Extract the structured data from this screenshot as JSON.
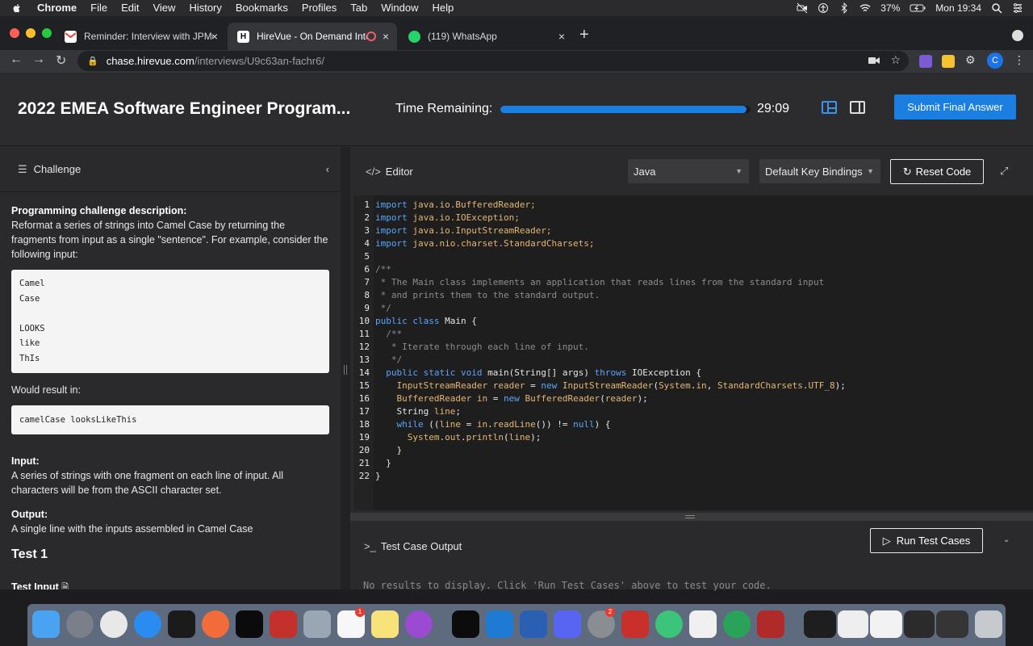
{
  "menubar": {
    "app": "Chrome",
    "items": [
      "File",
      "Edit",
      "View",
      "History",
      "Bookmarks",
      "Profiles",
      "Tab",
      "Window",
      "Help"
    ],
    "battery": "37%",
    "clock": "Mon 19:34"
  },
  "tabs": [
    {
      "title": "Reminder: Interview with JPMo",
      "close": "×"
    },
    {
      "title": "HireVue - On Demand Inter",
      "close": "×"
    },
    {
      "title": "(119) WhatsApp",
      "close": "×"
    }
  ],
  "toolbar": {
    "newtab": "+",
    "url_host": "chase.hirevue.com",
    "url_path": "/interviews/U9c63an-fachr6/",
    "profile_initial": "C"
  },
  "header": {
    "title": "2022 EMEA Software Engineer Program...",
    "time_label": "Time Remaining:",
    "time_value": "29:09",
    "progress": 0.985,
    "submit_label": "Submit Final Answer"
  },
  "challenge": {
    "tab_label": "Challenge",
    "heading": "Programming challenge description:",
    "desc": "Reformat a series of strings into Camel Case by returning the fragments from input as a single \"sentence\". For example, consider the following input:",
    "example_input": "Camel\nCase\n\nLOOKS\nlike\nThIs",
    "would_result": "Would result in:",
    "example_output": "camelCase looksLikeThis",
    "input_heading": "Input:",
    "input_desc": "A series of strings with one fragment on each line of input. All characters will be from the ASCII character set.",
    "output_heading": "Output:",
    "output_desc": "A single line with the inputs assembled in Camel Case",
    "test_title": "Test 1",
    "test_input_label": "Test Input"
  },
  "editor": {
    "label": "Editor",
    "language": "Java",
    "keybindings": "Default Key Bindings",
    "reset_label": "Reset Code",
    "lines": [
      "import java.io.BufferedReader;",
      "import java.io.IOException;",
      "import java.io.InputStreamReader;",
      "import java.nio.charset.StandardCharsets;",
      "",
      "/**",
      " * The Main class implements an application that reads lines from the standard input",
      " * and prints them to the standard output.",
      " */",
      "public class Main {",
      "  /**",
      "   * Iterate through each line of input.",
      "   */",
      "  public static void main(String[] args) throws IOException {",
      "    InputStreamReader reader = new InputStreamReader(System.in, StandardCharsets.UTF_8);",
      "    BufferedReader in = new BufferedReader(reader);",
      "    String line;",
      "    while ((line = in.readLine()) != null) {",
      "      System.out.println(line);",
      "    }",
      "  }",
      "}"
    ]
  },
  "output": {
    "label": "Test Case Output",
    "run_label": "Run Test Cases",
    "empty_text": "No results to display. Click 'Run Test Cases' above to test your code."
  },
  "dock": {
    "badges": [
      "1",
      "2"
    ]
  },
  "colors": {
    "accent": "#1a7fe0",
    "page_bg": "#2a2a2c",
    "editor_bg": "#1e1e1e",
    "keyword": "#58a6ff"
  }
}
